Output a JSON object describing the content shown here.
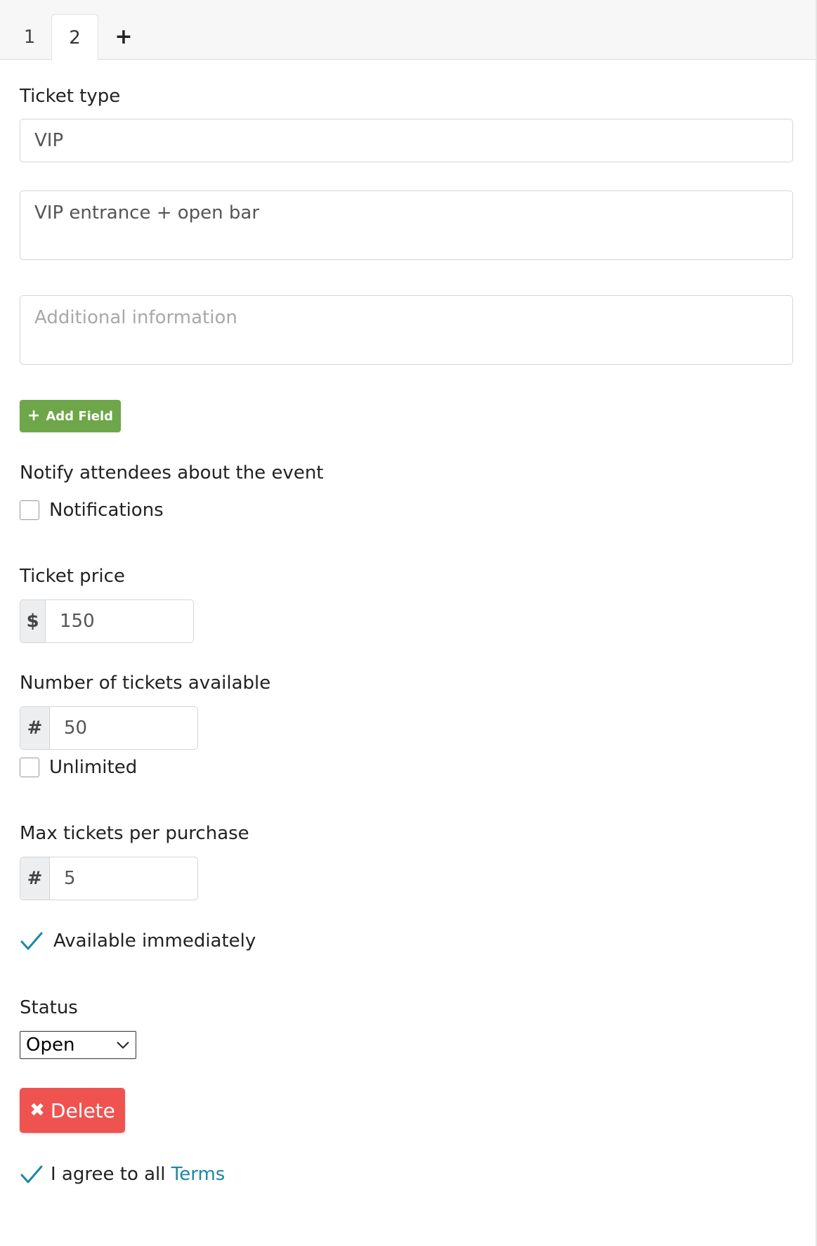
{
  "tabs": [
    {
      "label": "1"
    },
    {
      "label": "2"
    },
    {
      "label": "+"
    }
  ],
  "ticket_type": {
    "label": "Ticket type",
    "value": "VIP"
  },
  "description": {
    "value": "VIP entrance + open bar"
  },
  "additional_info": {
    "placeholder": "Additional information"
  },
  "add_field_button": {
    "icon": "+",
    "label": "Add Field",
    "color": "#6ea64a"
  },
  "notify": {
    "label": "Notify attendees about the event",
    "checkbox_label": "Notifications",
    "checked": false
  },
  "ticket_price": {
    "label": "Ticket price",
    "prefix": "$",
    "value": "150"
  },
  "tickets_available": {
    "label": "Number of tickets available",
    "prefix": "#",
    "value": "50",
    "unlimited_label": "Unlimited",
    "unlimited_checked": false
  },
  "max_per_purchase": {
    "label": "Max tickets per purchase",
    "prefix": "#",
    "value": "5"
  },
  "available_immediately": {
    "label": "Available immediately",
    "checked": true
  },
  "status": {
    "label": "Status",
    "selected": "Open"
  },
  "delete_button": {
    "icon": "✖",
    "label": "Delete",
    "color": "#ef5350"
  },
  "terms": {
    "prefix": "I agree to all ",
    "link_label": "Terms",
    "checked": true,
    "link_color": "#1a88a8"
  }
}
